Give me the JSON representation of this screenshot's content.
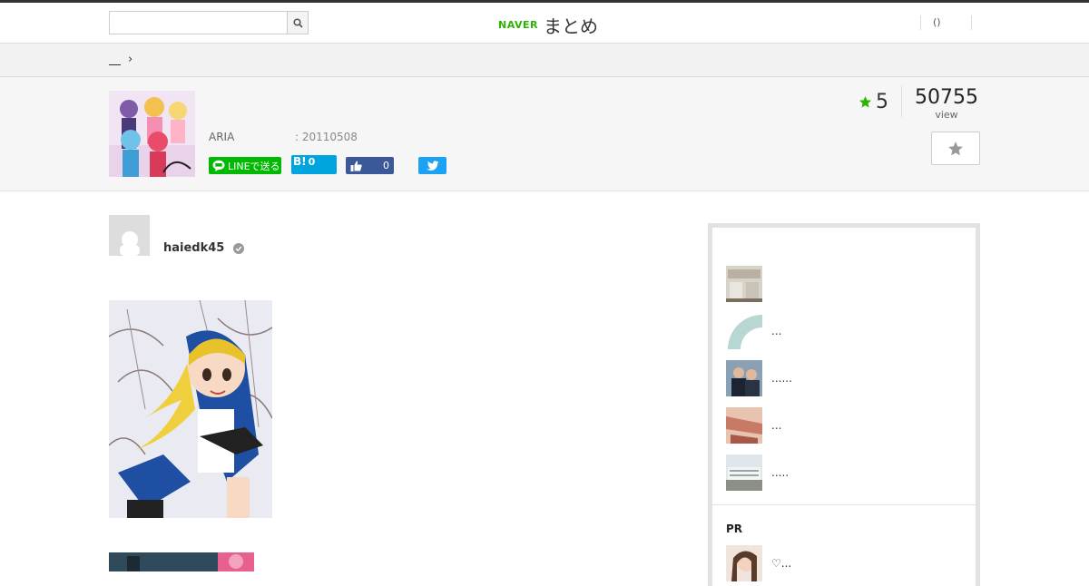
{
  "header": {
    "search_placeholder": "",
    "logo_naver": "NAVER",
    "logo_matome": "まとめ",
    "right_text": "()"
  },
  "breadcrumb": {
    "separator": "›"
  },
  "info": {
    "author_short": "ARIA",
    "date": ": 20110508",
    "line_label": "LINEで送る",
    "hatena_label": "B!",
    "hatena_count": "0",
    "fb_count": "0",
    "score": "5",
    "views": "50755",
    "views_label": "view"
  },
  "author": {
    "name": "haiedk45"
  },
  "sidebar": {
    "items": [
      {
        "text": ""
      },
      {
        "text": "..."
      },
      {
        "text": "......"
      },
      {
        "text": "..."
      },
      {
        "text": "....."
      }
    ],
    "pr_label": "PR",
    "pr_item": {
      "text": "♡..."
    }
  },
  "colors": {
    "naver_green": "#2db400",
    "line_green": "#00b900",
    "hatena_blue": "#00a4de",
    "facebook_blue": "#3b5998",
    "twitter_blue": "#1da1f2",
    "star_green": "#2db400"
  }
}
